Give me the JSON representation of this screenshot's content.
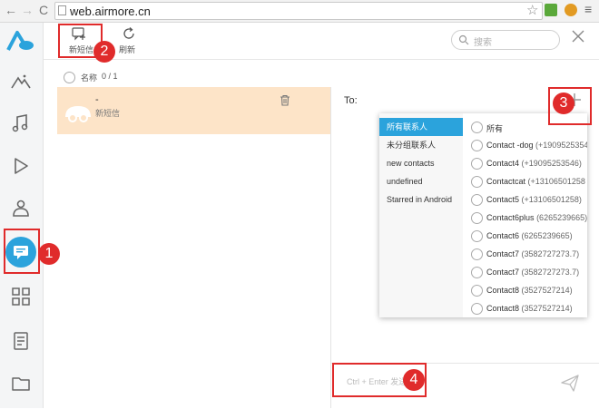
{
  "browser": {
    "back_icon": "back-arrow-icon",
    "forward_icon": "forward-arrow-icon",
    "reload_icon": "reload-icon",
    "url": "web.airmore.cn",
    "menu_icon": "hamburger-menu-icon"
  },
  "sidebar": {
    "logo_icon": "airmore-logo-icon",
    "items": [
      {
        "name": "photos",
        "icon": "mountain-icon"
      },
      {
        "name": "music",
        "icon": "music-note-icon"
      },
      {
        "name": "videos",
        "icon": "play-icon"
      },
      {
        "name": "contacts",
        "icon": "person-icon"
      },
      {
        "name": "messages",
        "icon": "message-icon",
        "active": true
      },
      {
        "name": "apps",
        "icon": "grid-icon"
      },
      {
        "name": "documents",
        "icon": "document-icon"
      },
      {
        "name": "files",
        "icon": "folder-icon"
      }
    ]
  },
  "toolbar": {
    "new_message_label": "新短信",
    "refresh_label": "刷新",
    "search_placeholder": "搜索"
  },
  "list": {
    "header_name_label": "名称",
    "header_count": "0 / 1",
    "message": {
      "title": "-",
      "subtitle": "新短信"
    }
  },
  "compose": {
    "to_label": "To:",
    "input_placeholder": "Ctrl + Enter 发送"
  },
  "groups": [
    {
      "label": "所有联系人",
      "active": true
    },
    {
      "label": "未分组联系人",
      "active": false
    },
    {
      "label": "new contacts",
      "active": false
    },
    {
      "label": "undefined",
      "active": false
    },
    {
      "label": "Starred in Android",
      "active": false
    }
  ],
  "contacts": [
    {
      "name": "所有",
      "number": ""
    },
    {
      "name": "Contact -dog",
      "number": "(+1909525354"
    },
    {
      "name": "Contact4",
      "number": "(+19095253546)"
    },
    {
      "name": "Contactcat",
      "number": "(+13106501258"
    },
    {
      "name": "Contact5",
      "number": "(+13106501258)"
    },
    {
      "name": "Contact6plus",
      "number": "(6265239665)"
    },
    {
      "name": "Contact6",
      "number": "(6265239665)"
    },
    {
      "name": "Contact7",
      "number": "(3582727273.7)"
    },
    {
      "name": "Contact7",
      "number": "(3582727273.7)"
    },
    {
      "name": "Contact8",
      "number": "(3527527214)"
    },
    {
      "name": "Contact8",
      "number": "(3527527214)"
    }
  ],
  "annotations": [
    "1",
    "2",
    "3",
    "4"
  ],
  "colors": {
    "accent": "#2ba3dc",
    "selected_row": "#fde4c8",
    "annotation": "#e02b2b"
  }
}
